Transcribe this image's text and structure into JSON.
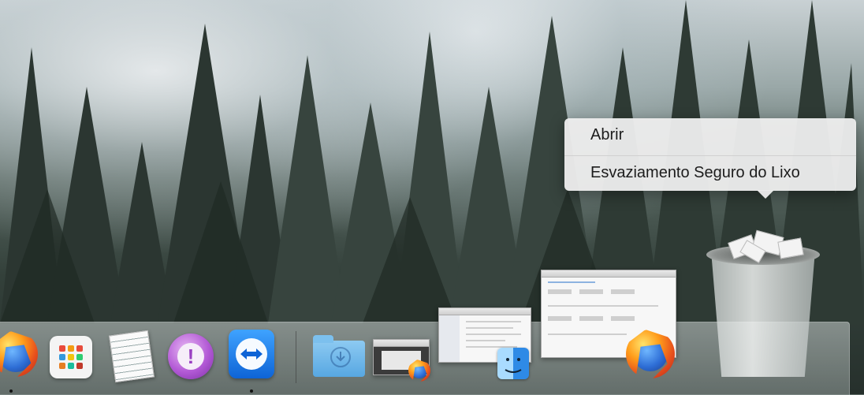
{
  "context_menu": {
    "items": [
      {
        "label": "Abrir"
      },
      {
        "label": "Esvaziamento Seguro do Lixo"
      }
    ]
  },
  "dock": {
    "items": [
      {
        "name": "firefox",
        "icon": "firefox-icon"
      },
      {
        "name": "launchpad",
        "icon": "launchpad-icon"
      },
      {
        "name": "textedit",
        "icon": "textedit-icon"
      },
      {
        "name": "feedback-assistant",
        "icon": "feedback-icon"
      },
      {
        "name": "teamviewer",
        "icon": "teamviewer-icon"
      },
      {
        "name": "downloads",
        "icon": "downloads-folder-icon"
      },
      {
        "name": "firefox-window",
        "icon": "window-thumbnail"
      },
      {
        "name": "finder-window",
        "icon": "window-thumbnail"
      },
      {
        "name": "firefox-window-large",
        "icon": "window-thumbnail"
      },
      {
        "name": "trash",
        "icon": "trash-full-icon"
      }
    ]
  },
  "colors": {
    "menu_bg": "#ececec",
    "dock_bg": "#b9c2c0",
    "firefox_orange": "#e8511d",
    "firefox_blue": "#2e6ed6"
  }
}
